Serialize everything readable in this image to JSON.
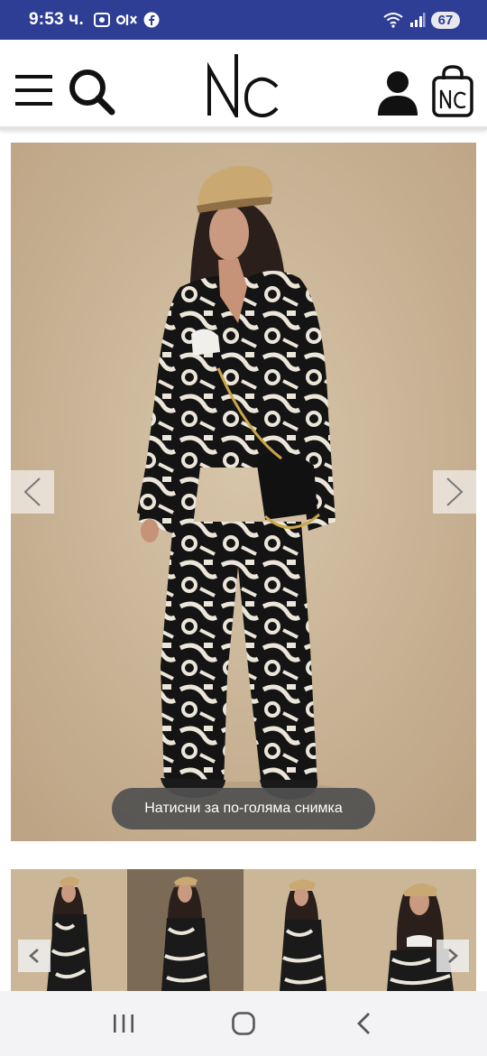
{
  "status_bar": {
    "time": "9:53 ч.",
    "battery": "67"
  },
  "header": {
    "logo_text": "NC",
    "cart_logo_text": "NC"
  },
  "gallery": {
    "zoom_hint": "Натисни за по-голяма снимка"
  },
  "thumbnails": {
    "count": 4
  },
  "colors": {
    "status_bar_bg": "#2f3e95",
    "backdrop": "#cdb89a"
  }
}
